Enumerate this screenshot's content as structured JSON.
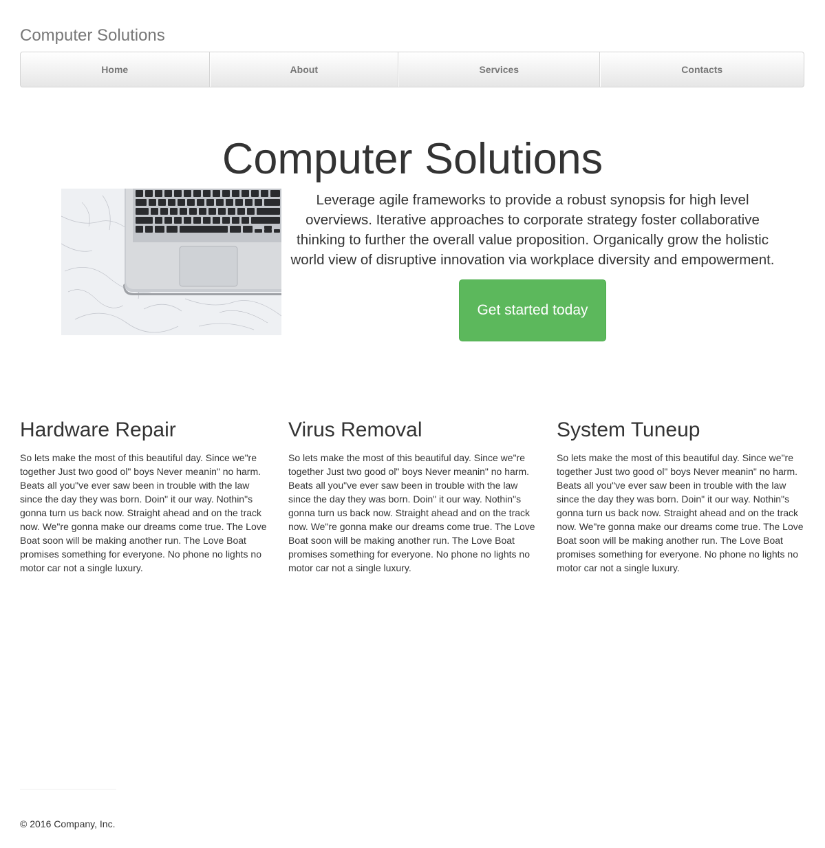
{
  "header": {
    "brand": "Computer Solutions"
  },
  "nav": {
    "items": [
      {
        "label": "Home"
      },
      {
        "label": "About"
      },
      {
        "label": "Services"
      },
      {
        "label": "Contacts"
      }
    ]
  },
  "hero": {
    "title": "Computer Solutions",
    "text": "Leverage agile frameworks to provide a robust synopsis for high level overviews. Iterative approaches to corporate strategy foster collaborative thinking to further the overall value proposition. Organically grow the holistic world view of disruptive innovation via workplace diversity and empowerment.",
    "cta_label": "Get started today",
    "cta_color": "#5cb85c",
    "image_icon": "laptop-on-marble-image"
  },
  "services": [
    {
      "title": "Hardware Repair",
      "text": "So lets make the most of this beautiful day. Since we\"re together Just two good ol\" boys Never meanin\" no harm. Beats all you\"ve ever saw been in trouble with the law since the day they was born. Doin\" it our way. Nothin\"s gonna turn us back now. Straight ahead and on the track now. We\"re gonna make our dreams come true. The Love Boat soon will be making another run. The Love Boat promises something for everyone. No phone no lights no motor car not a single luxury."
    },
    {
      "title": "Virus Removal",
      "text": "So lets make the most of this beautiful day. Since we\"re together Just two good ol\" boys Never meanin\" no harm. Beats all you\"ve ever saw been in trouble with the law since the day they was born. Doin\" it our way. Nothin\"s gonna turn us back now. Straight ahead and on the track now. We\"re gonna make our dreams come true. The Love Boat soon will be making another run. The Love Boat promises something for everyone. No phone no lights no motor car not a single luxury."
    },
    {
      "title": "System Tuneup",
      "text": "So lets make the most of this beautiful day. Since we\"re together Just two good ol\" boys Never meanin\" no harm. Beats all you\"ve ever saw been in trouble with the law since the day they was born. Doin\" it our way. Nothin\"s gonna turn us back now. Straight ahead and on the track now. We\"re gonna make our dreams come true. The Love Boat soon will be making another run. The Love Boat promises something for everyone. No phone no lights no motor car not a single luxury."
    }
  ],
  "footer": {
    "copyright": "© 2016 Company, Inc."
  }
}
